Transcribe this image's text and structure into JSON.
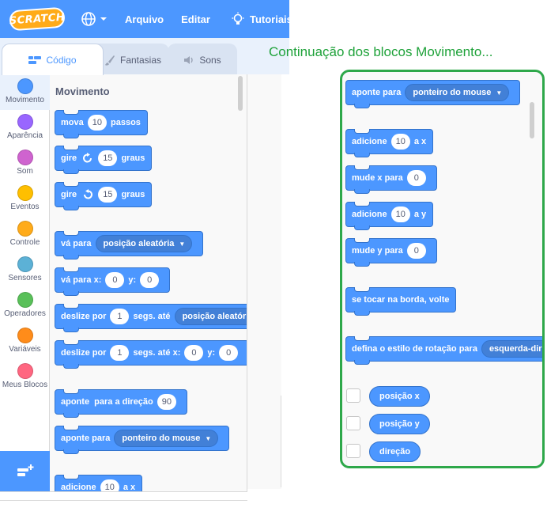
{
  "menubar": {
    "logo_text": "SCRATCH",
    "file_label": "Arquivo",
    "edit_label": "Editar",
    "tutorials_label": "Tutoriais"
  },
  "tabs": {
    "code": "Código",
    "costumes": "Fantasias",
    "sounds": "Sons"
  },
  "categories": [
    {
      "label": "Movimento",
      "color": "#4c97ff"
    },
    {
      "label": "Aparência",
      "color": "#9966ff"
    },
    {
      "label": "Som",
      "color": "#cf63cf"
    },
    {
      "label": "Eventos",
      "color": "#ffbf00"
    },
    {
      "label": "Controle",
      "color": "#ffab19"
    },
    {
      "label": "Sensores",
      "color": "#5cb1d6"
    },
    {
      "label": "Operadores",
      "color": "#59c059"
    },
    {
      "label": "Variáveis",
      "color": "#ff8c1a"
    },
    {
      "label": "Meus Blocos",
      "color": "#ff6680"
    }
  ],
  "palette": {
    "title": "Movimento",
    "mova": {
      "pre": "mova",
      "val": "10",
      "post": "passos"
    },
    "gire_right": {
      "pre": "gire",
      "val": "15",
      "post": "graus"
    },
    "gire_left": {
      "pre": "gire",
      "val": "15",
      "post": "graus"
    },
    "va_para": {
      "pre": "vá para",
      "drop": "posição aleatória"
    },
    "va_para_xy": {
      "pre": "vá para x:",
      "x": "0",
      "ymid": "y:",
      "y": "0"
    },
    "deslize_rand": {
      "pre": "deslize por",
      "val": "1",
      "mid": "segs. até",
      "drop": "posição aleatória"
    },
    "deslize_xy": {
      "pre": "deslize por",
      "val": "1",
      "mid": "segs. até x:",
      "x": "0",
      "ymid": "y:",
      "y": "0"
    },
    "aponte_dir": {
      "pre": "aponte  para a direção",
      "val": "90"
    },
    "aponte_para": {
      "pre": "aponte para",
      "drop": "ponteiro do mouse"
    },
    "adicione_x": {
      "pre": "adicione",
      "val": "10",
      "post": "a x"
    }
  },
  "note": "Continuação dos blocos Movimento...",
  "continuation": {
    "aponte_para": {
      "pre": "aponte para",
      "drop": "ponteiro do mouse"
    },
    "adicione_x": {
      "pre": "adicione",
      "val": "10",
      "post": "a x"
    },
    "mude_x": {
      "pre": "mude x para",
      "val": "0"
    },
    "adicione_y": {
      "pre": "adicione",
      "val": "10",
      "post": "a y"
    },
    "mude_y": {
      "pre": "mude y para",
      "val": "0"
    },
    "bounce": {
      "label": "se tocar na borda, volte"
    },
    "rotation": {
      "pre": "defina o estilo de rotação para",
      "drop": "esquerda-direita"
    },
    "reporters": [
      {
        "label": "posição x"
      },
      {
        "label": "posição y"
      },
      {
        "label": "direção"
      }
    ]
  }
}
